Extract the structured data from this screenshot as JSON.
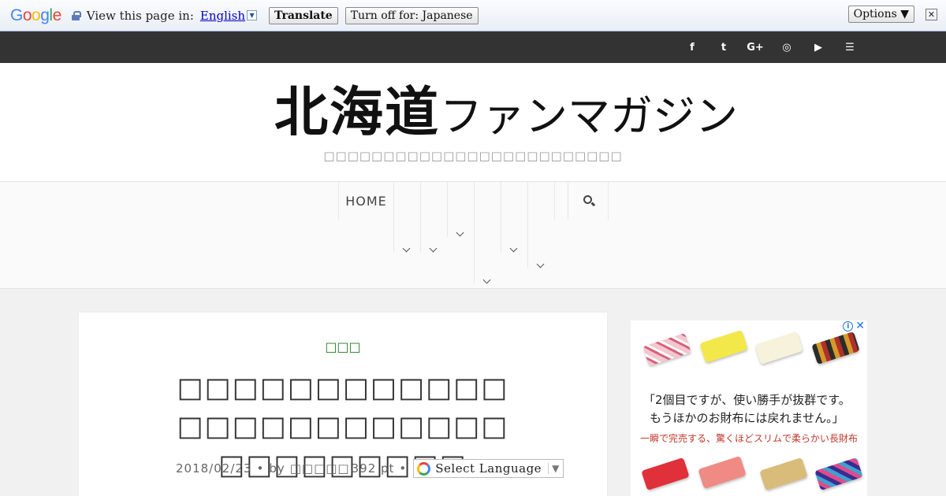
{
  "translate_bar": {
    "logo_letters": [
      "G",
      "o",
      "o",
      "g",
      "l",
      "e"
    ],
    "label": "View this page in:",
    "language": "English",
    "translate_button": "Translate",
    "turn_off_button": "Turn off for: Japanese",
    "options_button": "Options ▼",
    "close_symbol": "✕"
  },
  "social": {
    "icons": [
      "facebook-icon",
      "twitter-icon",
      "google-plus-icon",
      "instagram-icon",
      "youtube-icon",
      "rss-icon"
    ],
    "glyphs": [
      "f",
      "t",
      "G+",
      "◎",
      "▶",
      "☰"
    ]
  },
  "header": {
    "logo_main": "北海道",
    "logo_sub": "ファンマガジン",
    "tagline": "□□□□□□□□□□□□□□□□□□□□□□□□□"
  },
  "nav": {
    "home_label": "HOME"
  },
  "article": {
    "category": "□□□",
    "title_line1": "□□□□□□□□□□□□ □□□□□□□□□□□□",
    "title_line2": "□□□□□□□□□",
    "date": "2018/02/23",
    "by": "by",
    "author": "□□□□□",
    "points": "392 pt",
    "sep": "•",
    "language_select": "Select Language",
    "language_select_arrow": "▼"
  },
  "ad": {
    "info_symbol": "i",
    "close_symbol": "✕",
    "quote_line1": "「2個目ですが、使い勝手が抜群です。",
    "quote_line2": "もうほかのお財布には戻れません。」",
    "tagline": "一瞬で完売する、驚くほどスリムで柔らかい長財布"
  }
}
